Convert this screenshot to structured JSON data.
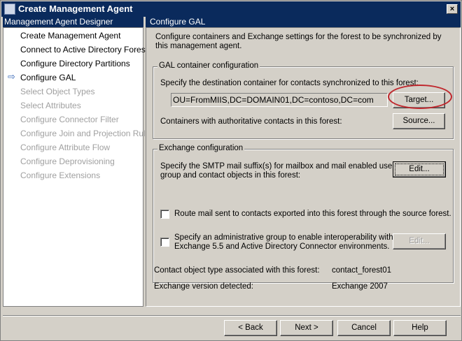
{
  "window": {
    "title": "Create Management Agent",
    "close": "×"
  },
  "left": {
    "header": "Management Agent Designer",
    "items": [
      {
        "label": "Create Management Agent",
        "enabled": true
      },
      {
        "label": "Connect to Active Directory Forest",
        "enabled": true
      },
      {
        "label": "Configure Directory Partitions",
        "enabled": true
      },
      {
        "label": "Configure GAL",
        "enabled": true,
        "current": true
      },
      {
        "label": "Select Object Types",
        "enabled": false
      },
      {
        "label": "Select Attributes",
        "enabled": false
      },
      {
        "label": "Configure Connector Filter",
        "enabled": false
      },
      {
        "label": "Configure Join and Projection Rules",
        "enabled": false
      },
      {
        "label": "Configure Attribute Flow",
        "enabled": false
      },
      {
        "label": "Configure Deprovisioning",
        "enabled": false
      },
      {
        "label": "Configure Extensions",
        "enabled": false
      }
    ],
    "arrow": "⇨"
  },
  "right": {
    "header": "Configure GAL",
    "intro1": "Configure containers and Exchange settings for the forest to be synchronized by",
    "intro2": "this management agent.",
    "gal": {
      "title": "GAL container configuration",
      "dest_label": "Specify the destination container for contacts synchronized to this forest:",
      "dest_value": "OU=FromMIIS,DC=DOMAIN01,DC=contoso,DC=com",
      "target": "Target...",
      "auth_label": "Containers with authoritative contacts in this forest:",
      "source": "Source..."
    },
    "exchange": {
      "title": "Exchange configuration",
      "smtp1": "Specify the SMTP mail suffix(s) for mailbox and mail enabled user,",
      "smtp2": "group and contact objects in this forest:",
      "edit": "Edit...",
      "route": "Route mail sent to contacts exported into this forest through the source forest.",
      "admin1": "Specify an administrative group to enable interoperability with",
      "admin2": "Exchange 5.5 and Active Directory Connector environments.",
      "edit2": "Edit..."
    },
    "contact_label": "Contact object type associated with this forest:",
    "contact_value": "contact_forest01",
    "version_label": "Exchange version detected:",
    "version_value": "Exchange 2007"
  },
  "buttons": {
    "back": "< Back",
    "next": "Next >",
    "cancel": "Cancel",
    "help": "Help"
  }
}
